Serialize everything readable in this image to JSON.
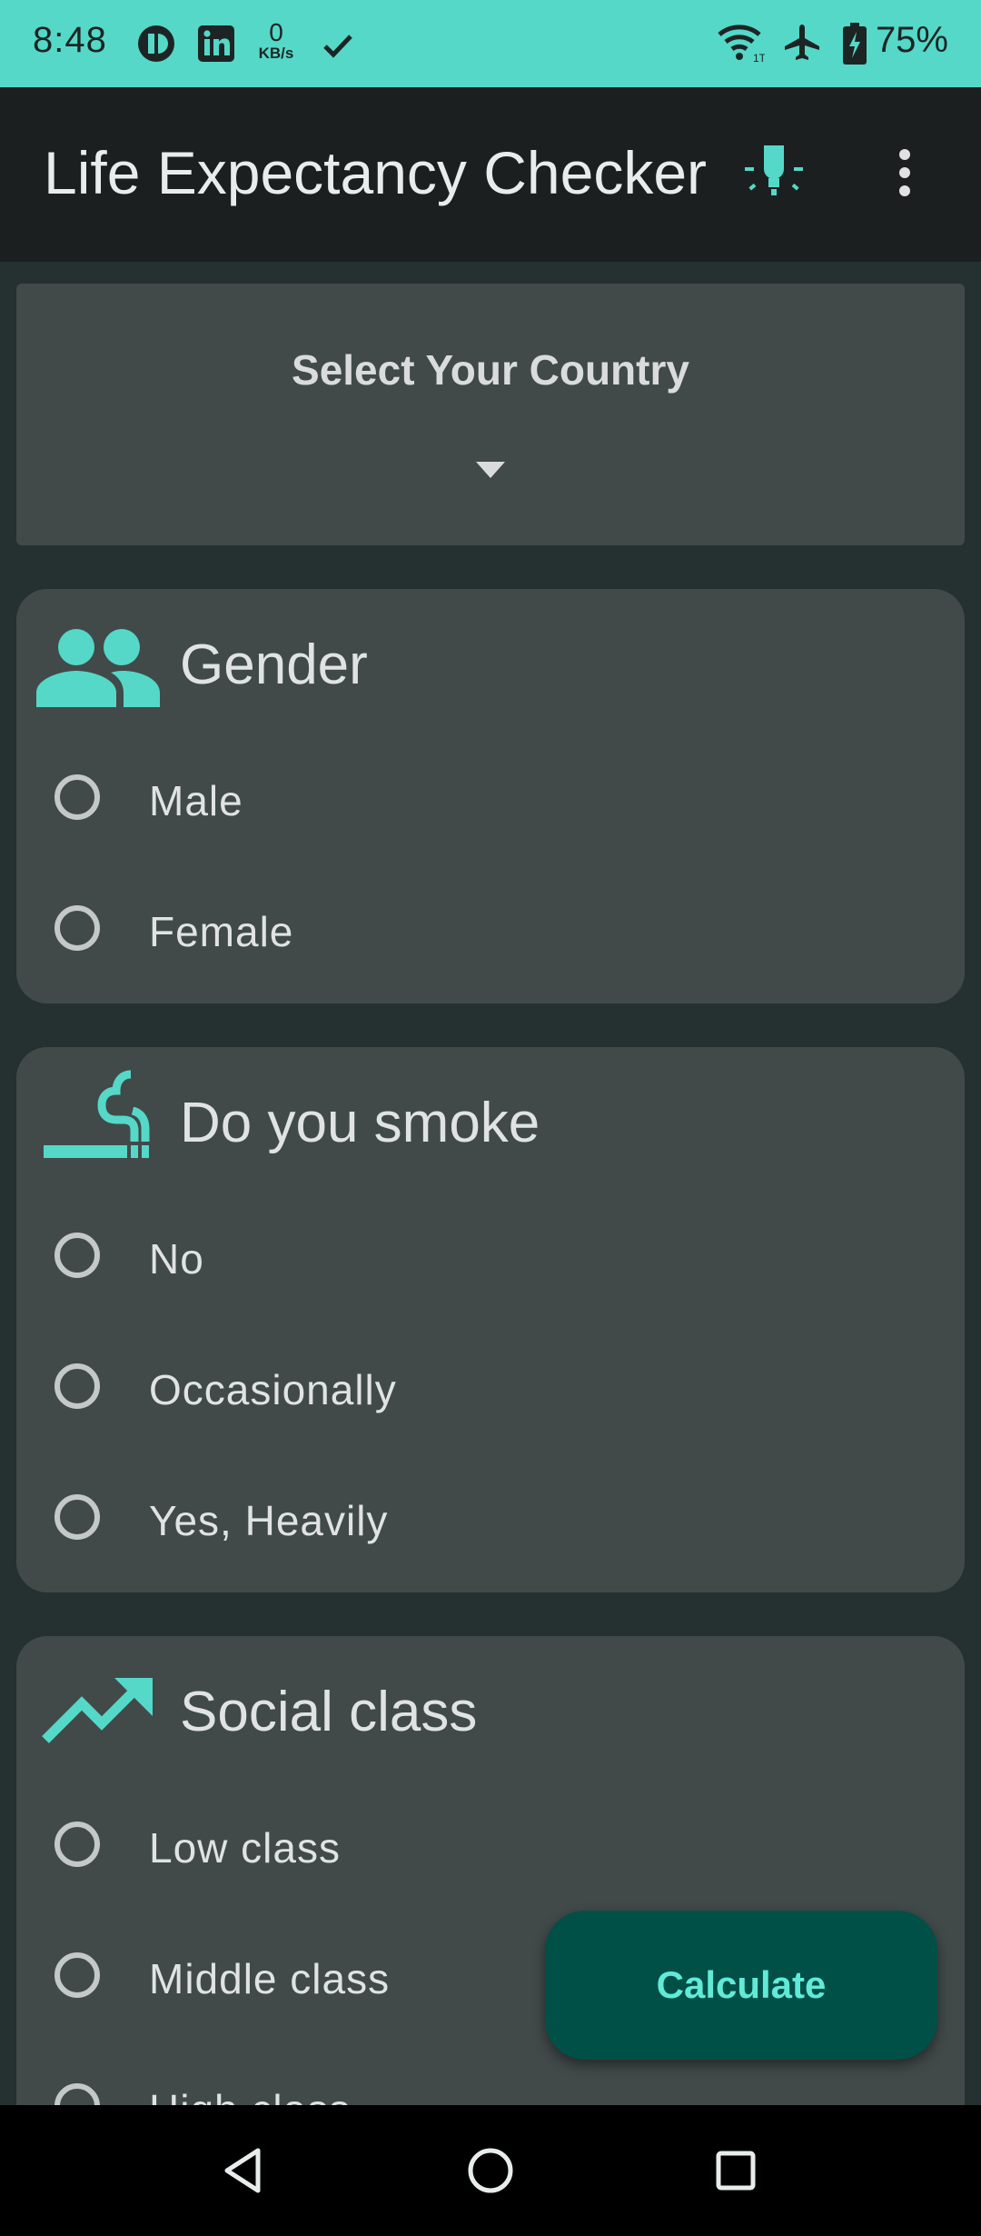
{
  "colors": {
    "accent": "#55d8c8",
    "background": "#243130",
    "card": "#414a49",
    "app_bar": "#1c1f1f",
    "fab": "#005048",
    "fab_text": "#62ead8"
  },
  "status_bar": {
    "time": "8:48",
    "speed_value": "0",
    "speed_unit": "KB/s",
    "battery": "75%",
    "icons": [
      "app-icon",
      "linkedin-icon",
      "network-speed-icon",
      "check-icon",
      "wifi-icon",
      "airplane-mode-icon",
      "battery-charging-icon"
    ]
  },
  "app_bar": {
    "title": "Life Expectancy Checker",
    "icons": [
      "lightbulb-icon",
      "more-vert-icon"
    ]
  },
  "country": {
    "label": "Select Your Country",
    "icon": "dropdown-arrow-icon"
  },
  "gender": {
    "title": "Gender",
    "icon": "people-icon",
    "options": [
      "Male",
      "Female"
    ]
  },
  "smoke": {
    "title": "Do you smoke",
    "icon": "smoking-icon",
    "options": [
      "No",
      "Occasionally",
      "Yes, Heavily"
    ]
  },
  "social": {
    "title": "Social class",
    "icon": "trending-up-icon",
    "options": [
      "Low class",
      "Middle class",
      "High class"
    ]
  },
  "fab": {
    "label": "Calculate"
  },
  "nav_bar": {
    "icons": [
      "back-icon",
      "home-icon",
      "recents-icon"
    ]
  }
}
